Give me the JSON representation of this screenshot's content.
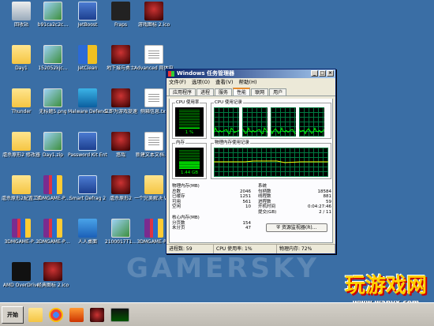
{
  "desktop": {
    "icons": [
      {
        "label": "回收站",
        "icon": "recycle-bin-icon"
      },
      {
        "label": "b91ca2c2c…",
        "icon": "image-file-icon"
      },
      {
        "label": "JetBoost",
        "icon": "jetboost-icon"
      },
      {
        "label": "Fraps",
        "icon": "fraps-icon"
      },
      {
        "label": "游戏图标 2.ico",
        "icon": "game-icon"
      },
      {
        "label": "Day1",
        "icon": "folder-icon"
      },
      {
        "label": "152052kjc…",
        "icon": "image-file-icon"
      },
      {
        "label": "JetClean",
        "icon": "jetclean-icon"
      },
      {
        "label": "地下城与勇士",
        "icon": "game-icon"
      },
      {
        "label": "Advanced 简体中文…",
        "icon": "document-icon"
      },
      {
        "label": "Thunder",
        "icon": "folder-icon"
      },
      {
        "label": "无标题5.png",
        "icon": "image-file-icon"
      },
      {
        "label": "Malware Defender",
        "icon": "malware-defender-icon"
      },
      {
        "label": "立即为游戏提速",
        "icon": "game-icon"
      },
      {
        "label": "侧箱信息.txt",
        "icon": "document-icon"
      },
      {
        "label": "虐杀原形2 修改器",
        "icon": "folder-icon"
      },
      {
        "label": "Day1.zip",
        "icon": "image-file-icon"
      },
      {
        "label": "Password Kit Enterprise",
        "icon": "password-kit-icon"
      },
      {
        "label": "悠哉",
        "icon": "game-icon"
      },
      {
        "label": "新建文本文档.txt",
        "icon": "document-icon"
      },
      {
        "label": "虐杀原形2配置工具",
        "icon": "folder-icon"
      },
      {
        "label": "3DMGAME-P…",
        "icon": "archive-icon"
      },
      {
        "label": "Smart Defrag 2",
        "icon": "defrag-icon"
      },
      {
        "label": "虐杀原形2",
        "icon": "game-icon"
      },
      {
        "label": "一个完美解决 WIN8A版",
        "icon": "folder-icon"
      },
      {
        "label": "3DMGAME-P…",
        "icon": "archive-icon"
      },
      {
        "label": "3DMGAME-P…",
        "icon": "archive-icon"
      },
      {
        "label": "人人桌面",
        "icon": "renren-icon"
      },
      {
        "label": "2100017T1…",
        "icon": "image-file-icon"
      },
      {
        "label": "3DMGAME-P…",
        "icon": "archive-icon"
      },
      {
        "label": "AMD OverDrive",
        "icon": "amd-icon"
      },
      {
        "label": "经典图标 2.ico",
        "icon": "game-icon"
      }
    ]
  },
  "taskmgr": {
    "title": "Windows 任务管理器",
    "menus": [
      "文件(F)",
      "选项(O)",
      "查看(V)",
      "帮助(H)"
    ],
    "tabs": [
      "应用程序",
      "进程",
      "服务",
      "性能",
      "联网",
      "用户"
    ],
    "active_tab": "性能",
    "cpu_usage_caption": "CPU 使用率",
    "cpu_usage_value": "1 %",
    "cpu_usage_level": 0.01,
    "cpu_history_caption": "CPU 使用记录",
    "mem_caption": "内存",
    "mem_value": "1.44 GB",
    "mem_level": 0.36,
    "mem_history_caption": "物理内存使用记录",
    "physical_mem": {
      "title": "物理内存(MB)",
      "rows": [
        [
          "总数",
          "2046"
        ],
        [
          "已缓存",
          "1251"
        ],
        [
          "可用",
          "561"
        ],
        [
          "空闲",
          "10"
        ]
      ]
    },
    "system": {
      "title": "系统",
      "rows": [
        [
          "句柄数",
          "18584"
        ],
        [
          "线程数",
          "881"
        ],
        [
          "进程数",
          "59"
        ],
        [
          "开机时间",
          "0:04:27:46"
        ],
        [
          "提交(GB)",
          "2 / 11"
        ]
      ]
    },
    "kernel_mem": {
      "title": "核心内存(MB)",
      "rows": [
        [
          "分页数",
          "154"
        ],
        [
          "未分页",
          "47"
        ]
      ]
    },
    "resource_monitor_label": "资源监视器(R)...",
    "status": {
      "processes": "进程数: 59",
      "cpu": "CPU 使用率: 1%",
      "memory": "物理内存: 72%"
    }
  },
  "taskbar": {
    "start_label": "开始",
    "clock": "",
    "quick_icons": [
      "folder-icon",
      "chrome-icon",
      "media-player-icon",
      "game-icon",
      "taskmgr-icon"
    ]
  },
  "watermarks": {
    "center": "GAMERSKY",
    "logo": "玩游戏网",
    "url": "www.wanyx.com"
  },
  "colors": {
    "desktop": "#3a6ea5",
    "graph_green": "#00ff00",
    "title_blue": "#0a246a"
  }
}
